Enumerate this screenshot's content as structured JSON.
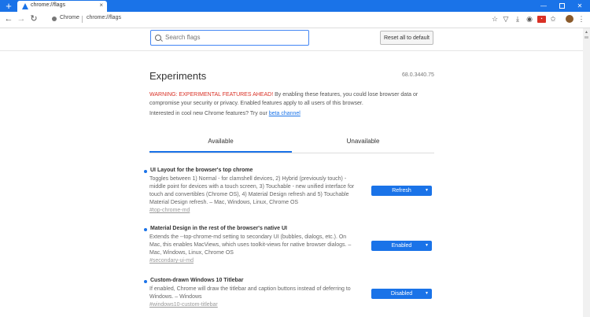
{
  "browser": {
    "tab_title": "chrome://flags",
    "tab_close": "×",
    "new_tab": "+",
    "scheme_label": "Chrome",
    "url": "chrome://flags",
    "win_min": "—",
    "win_close": "✕"
  },
  "header": {
    "search_placeholder": "Search flags",
    "reset_label": "Reset all to default"
  },
  "main": {
    "title": "Experiments",
    "version": "68.0.3440.75",
    "warning_label": "WARNING: EXPERIMENTAL FEATURES AHEAD!",
    "warning_text": " By enabling these features, you could lose browser data or compromise your security or privacy. Enabled features apply to all users of this browser.",
    "interest_text": "Interested in cool new Chrome features? Try our ",
    "interest_link": "beta channel",
    "tabs": [
      {
        "label": "Available"
      },
      {
        "label": "Unavailable"
      }
    ]
  },
  "experiments": [
    {
      "title": "UI Layout for the browser's top chrome",
      "description": "Toggles between 1) Normal - for clamshell devices, 2) Hybrid (previously touch) - middle point for devices with a touch screen, 3) Touchable - new unified interface for touch and convertibles (Chrome OS), 4) Material Design refresh and 5) Touchable Material Design refresh. – Mac, Windows, Linux, Chrome OS",
      "link": "#top-chrome-md",
      "value": "Refresh"
    },
    {
      "title": "Material Design in the rest of the browser's native UI",
      "description": "Extends the --top-chrome-md setting to secondary UI (bubbles, dialogs, etc.). On Mac, this enables MacViews, which uses toolkit-views for native browser dialogs. – Mac, Windows, Linux, Chrome OS",
      "link": "#secondary-ui-md",
      "value": "Enabled"
    },
    {
      "title": "Custom-drawn Windows 10 Titlebar",
      "description": "If enabled, Chrome will draw the titlebar and caption buttons instead of deferring to Windows. – Windows",
      "link": "#windows10-custom-titlebar",
      "value": "Disabled"
    }
  ],
  "colors": {
    "accent": "#1a73e8",
    "warning": "#d93025"
  },
  "icons": {
    "back": "arrow-left-icon",
    "forward": "arrow-right-icon",
    "reload": "reload-icon",
    "star": "star-icon",
    "menu": "kebab-menu-icon"
  }
}
